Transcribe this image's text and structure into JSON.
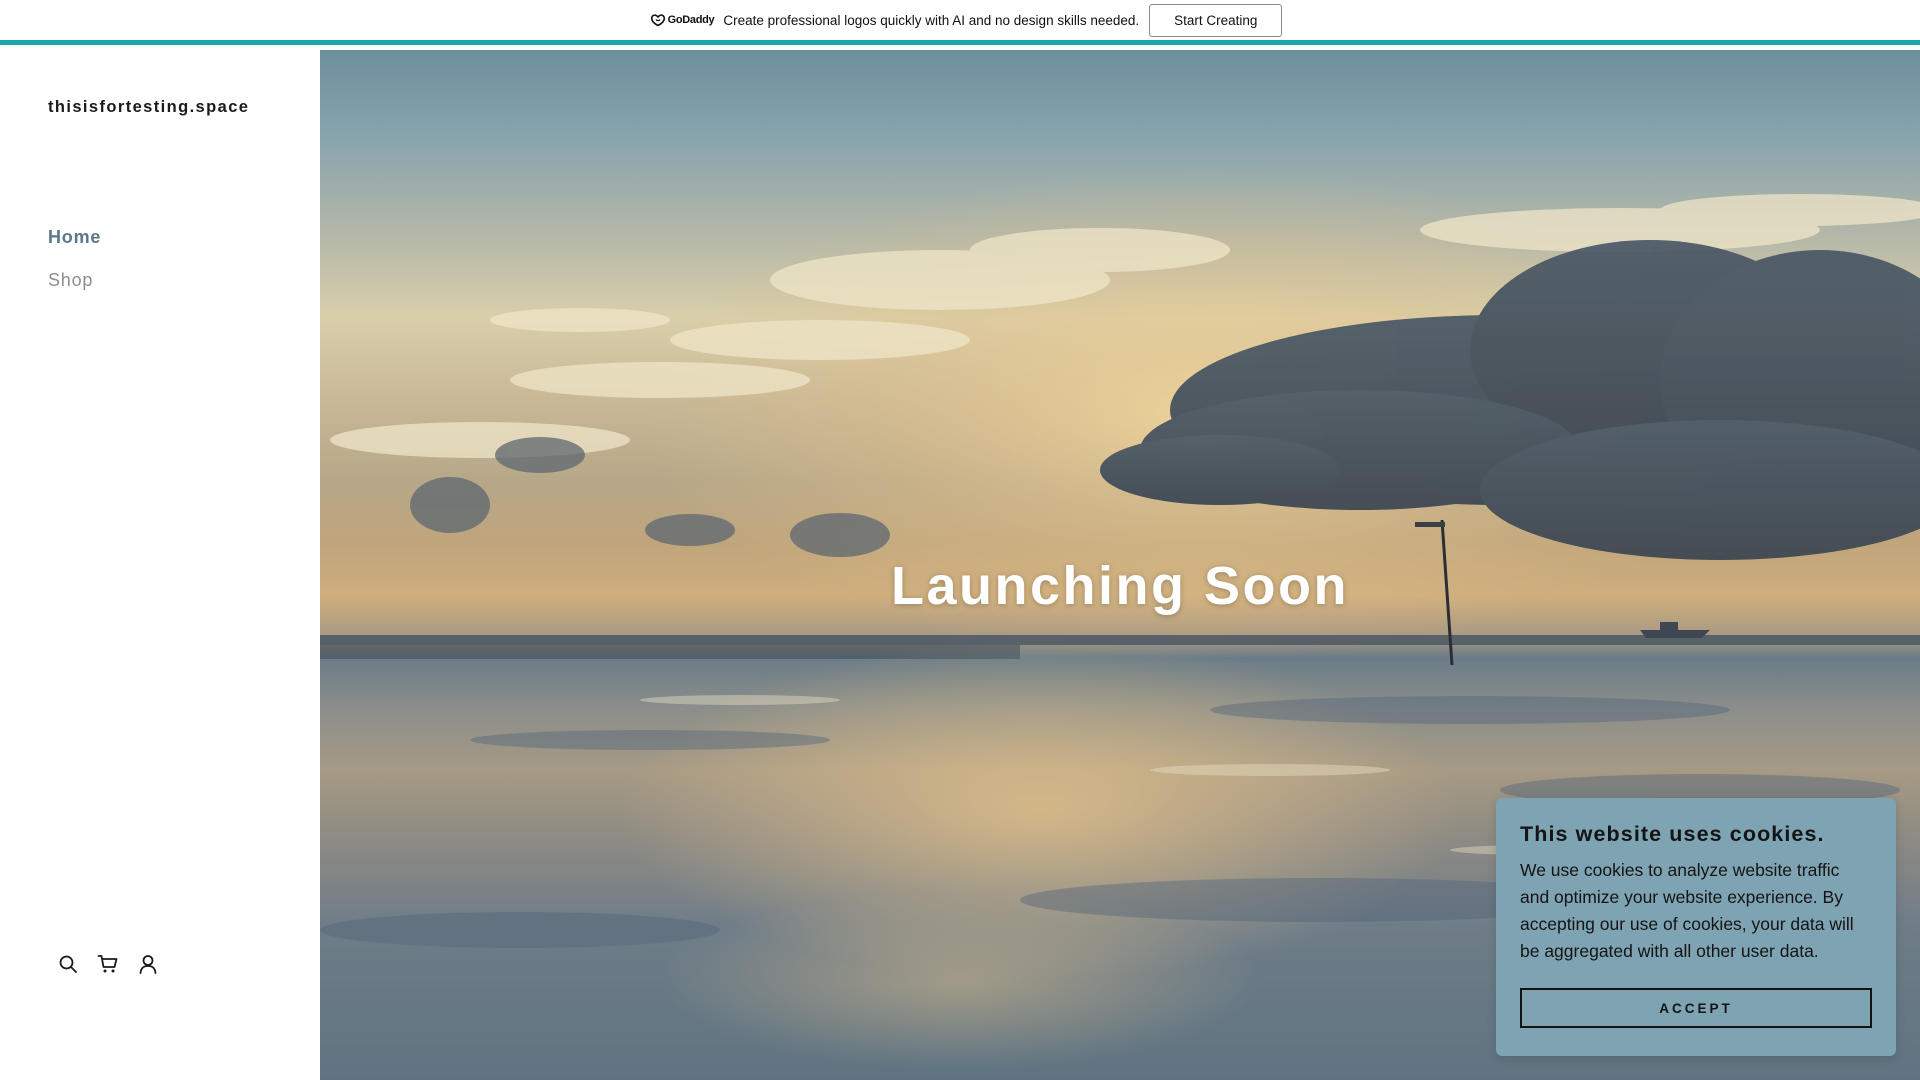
{
  "promo": {
    "brand": "GoDaddy",
    "message": "Create professional logos quickly with AI and no design skills needed.",
    "cta_label": "Start Creating",
    "accent_color": "#1aa5ab"
  },
  "sidebar": {
    "site_title": "thisisfortesting.space",
    "nav": [
      {
        "label": "Home",
        "active": true
      },
      {
        "label": "Shop",
        "active": false
      }
    ],
    "icons": [
      "search-icon",
      "cart-icon",
      "account-icon"
    ]
  },
  "hero": {
    "title": "Launching Soon"
  },
  "cookie": {
    "title": "This website uses cookies.",
    "body": "We use cookies to analyze website traffic and optimize your website experience. By accepting our use of cookies, your data will be aggregated with all other user data.",
    "accept_label": "ACCEPT",
    "background_color": "#7ea3b3"
  }
}
